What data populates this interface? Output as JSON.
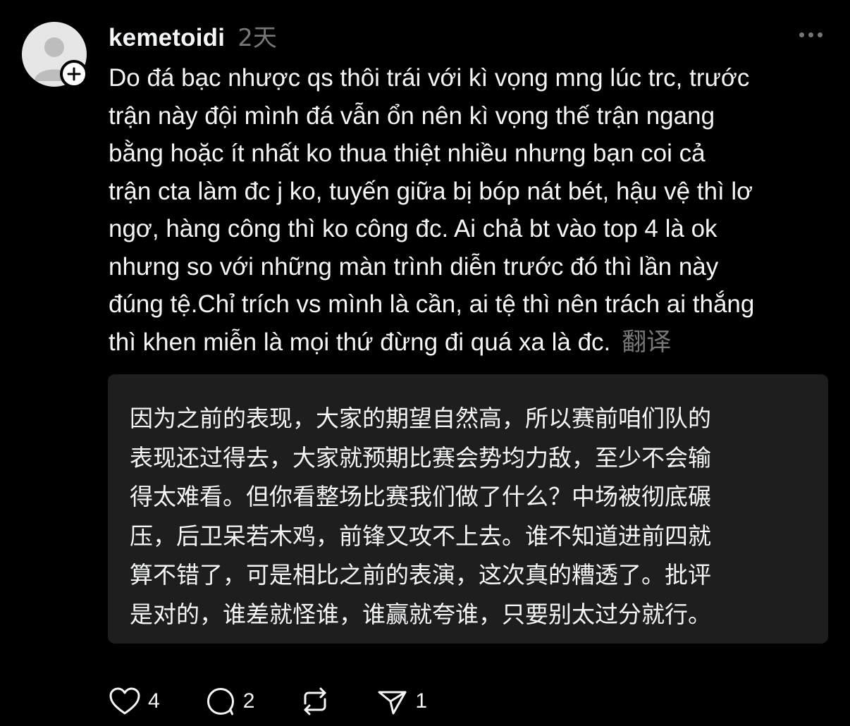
{
  "post": {
    "username": "kemetoidi",
    "time": "2天",
    "body_lines": [
      "Do đá bạc nhược qs thôi trái với kì vọng mng lúc trc, trước",
      "trận này đội mình đá vẫn ổn nên kì vọng thế trận ngang",
      "bằng hoặc ít nhất ko thua thiệt nhiều nhưng bạn coi cả",
      "trận cta làm đc j ko, tuyến giữa bị bóp nát bét, hậu vệ thì lơ",
      "ngơ, hàng công thì ko công đc. Ai chả bt vào top 4 là ok",
      "nhưng so với những màn trình diễn trước đó thì lần này",
      "đúng tệ.Chỉ trích vs mình là cần, ai tệ thì nên trách ai thắng",
      "thì khen miễn là mọi thứ đừng đi quá xa là đc."
    ],
    "translate_label": "翻译",
    "translation_lines": [
      "因为之前的表现，大家的期望自然高，所以赛前咱们队的",
      "表现还过得去，大家就预期比赛会势均力敌，至少不会输",
      "得太难看。但你看整场比赛我们做了什么？中场被彻底碾",
      "压，后卫呆若木鸡，前锋又攻不上去。谁不知道进前四就",
      "算不错了，可是相比之前的表演，这次真的糟透了。批评",
      "是对的，谁差就怪谁，谁赢就夸谁，只要别太过分就行。"
    ]
  },
  "actions": {
    "like_icon": "heart-icon",
    "like_count": "4",
    "reply_icon": "comment-icon",
    "reply_count": "2",
    "repost_icon": "repost-icon",
    "share_icon": "send-icon",
    "share_count": "1"
  },
  "colors": {
    "background": "#000000",
    "text": "#f3f5f7",
    "muted": "#777777",
    "translation_bg": "#1e1e1e"
  }
}
